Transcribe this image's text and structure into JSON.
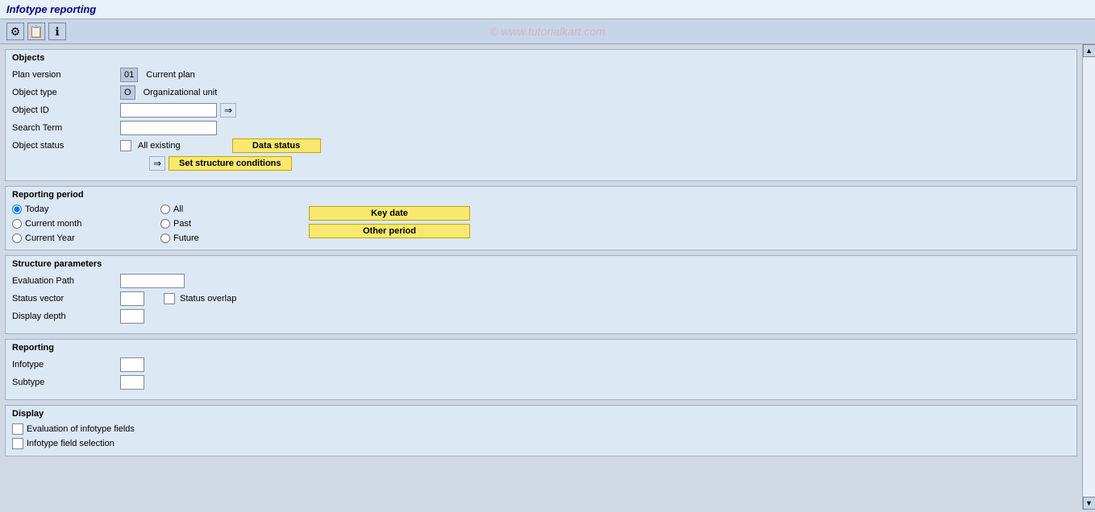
{
  "title": "Infotype reporting",
  "toolbar": {
    "watermark": "© www.tutorialkart.com",
    "btn1": "⚙",
    "btn2": "📋",
    "btn3": "ℹ"
  },
  "objects": {
    "section_title": "Objects",
    "plan_version_label": "Plan version",
    "plan_version_value": "01",
    "plan_version_text": "Current plan",
    "object_type_label": "Object type",
    "object_type_value": "O",
    "object_type_text": "Organizational unit",
    "object_id_label": "Object ID",
    "search_term_label": "Search Term",
    "object_status_label": "Object status",
    "object_status_text": "All existing",
    "data_status_btn": "Data status",
    "set_structure_btn": "Set structure conditions"
  },
  "reporting_period": {
    "section_title": "Reporting period",
    "radio_today": "Today",
    "radio_current_month": "Current month",
    "radio_current_year": "Current Year",
    "radio_all": "All",
    "radio_past": "Past",
    "radio_future": "Future",
    "btn_key_date": "Key date",
    "btn_other_period": "Other period"
  },
  "structure_parameters": {
    "section_title": "Structure parameters",
    "evaluation_path_label": "Evaluation Path",
    "status_vector_label": "Status vector",
    "display_depth_label": "Display depth",
    "status_overlap_label": "Status overlap"
  },
  "reporting": {
    "section_title": "Reporting",
    "infotype_label": "Infotype",
    "subtype_label": "Subtype"
  },
  "display": {
    "section_title": "Display",
    "eval_infotype_label": "Evaluation of infotype fields",
    "infotype_field_sel_label": "Infotype field selection"
  }
}
